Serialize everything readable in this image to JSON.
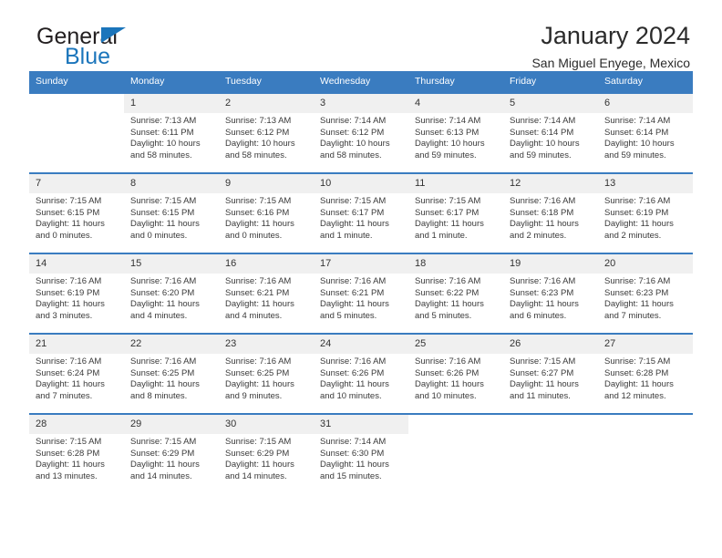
{
  "brand": {
    "name_dark": "General",
    "name_blue": "Blue",
    "accent_color": "#1b75bb"
  },
  "header": {
    "title": "January 2024",
    "subtitle": "San Miguel Enyege, Mexico"
  },
  "theme": {
    "header_row_bg": "#3a7cc0",
    "daynum_bg": "#f0f0f0",
    "text_color": "#3a3a3a"
  },
  "weekday_headers": [
    "Sunday",
    "Monday",
    "Tuesday",
    "Wednesday",
    "Thursday",
    "Friday",
    "Saturday"
  ],
  "weeks": [
    [
      {
        "day": "",
        "sunrise": "",
        "sunset": "",
        "daylight": ""
      },
      {
        "day": "1",
        "sunrise": "Sunrise: 7:13 AM",
        "sunset": "Sunset: 6:11 PM",
        "daylight": "Daylight: 10 hours and 58 minutes."
      },
      {
        "day": "2",
        "sunrise": "Sunrise: 7:13 AM",
        "sunset": "Sunset: 6:12 PM",
        "daylight": "Daylight: 10 hours and 58 minutes."
      },
      {
        "day": "3",
        "sunrise": "Sunrise: 7:14 AM",
        "sunset": "Sunset: 6:12 PM",
        "daylight": "Daylight: 10 hours and 58 minutes."
      },
      {
        "day": "4",
        "sunrise": "Sunrise: 7:14 AM",
        "sunset": "Sunset: 6:13 PM",
        "daylight": "Daylight: 10 hours and 59 minutes."
      },
      {
        "day": "5",
        "sunrise": "Sunrise: 7:14 AM",
        "sunset": "Sunset: 6:14 PM",
        "daylight": "Daylight: 10 hours and 59 minutes."
      },
      {
        "day": "6",
        "sunrise": "Sunrise: 7:14 AM",
        "sunset": "Sunset: 6:14 PM",
        "daylight": "Daylight: 10 hours and 59 minutes."
      }
    ],
    [
      {
        "day": "7",
        "sunrise": "Sunrise: 7:15 AM",
        "sunset": "Sunset: 6:15 PM",
        "daylight": "Daylight: 11 hours and 0 minutes."
      },
      {
        "day": "8",
        "sunrise": "Sunrise: 7:15 AM",
        "sunset": "Sunset: 6:15 PM",
        "daylight": "Daylight: 11 hours and 0 minutes."
      },
      {
        "day": "9",
        "sunrise": "Sunrise: 7:15 AM",
        "sunset": "Sunset: 6:16 PM",
        "daylight": "Daylight: 11 hours and 0 minutes."
      },
      {
        "day": "10",
        "sunrise": "Sunrise: 7:15 AM",
        "sunset": "Sunset: 6:17 PM",
        "daylight": "Daylight: 11 hours and 1 minute."
      },
      {
        "day": "11",
        "sunrise": "Sunrise: 7:15 AM",
        "sunset": "Sunset: 6:17 PM",
        "daylight": "Daylight: 11 hours and 1 minute."
      },
      {
        "day": "12",
        "sunrise": "Sunrise: 7:16 AM",
        "sunset": "Sunset: 6:18 PM",
        "daylight": "Daylight: 11 hours and 2 minutes."
      },
      {
        "day": "13",
        "sunrise": "Sunrise: 7:16 AM",
        "sunset": "Sunset: 6:19 PM",
        "daylight": "Daylight: 11 hours and 2 minutes."
      }
    ],
    [
      {
        "day": "14",
        "sunrise": "Sunrise: 7:16 AM",
        "sunset": "Sunset: 6:19 PM",
        "daylight": "Daylight: 11 hours and 3 minutes."
      },
      {
        "day": "15",
        "sunrise": "Sunrise: 7:16 AM",
        "sunset": "Sunset: 6:20 PM",
        "daylight": "Daylight: 11 hours and 4 minutes."
      },
      {
        "day": "16",
        "sunrise": "Sunrise: 7:16 AM",
        "sunset": "Sunset: 6:21 PM",
        "daylight": "Daylight: 11 hours and 4 minutes."
      },
      {
        "day": "17",
        "sunrise": "Sunrise: 7:16 AM",
        "sunset": "Sunset: 6:21 PM",
        "daylight": "Daylight: 11 hours and 5 minutes."
      },
      {
        "day": "18",
        "sunrise": "Sunrise: 7:16 AM",
        "sunset": "Sunset: 6:22 PM",
        "daylight": "Daylight: 11 hours and 5 minutes."
      },
      {
        "day": "19",
        "sunrise": "Sunrise: 7:16 AM",
        "sunset": "Sunset: 6:23 PM",
        "daylight": "Daylight: 11 hours and 6 minutes."
      },
      {
        "day": "20",
        "sunrise": "Sunrise: 7:16 AM",
        "sunset": "Sunset: 6:23 PM",
        "daylight": "Daylight: 11 hours and 7 minutes."
      }
    ],
    [
      {
        "day": "21",
        "sunrise": "Sunrise: 7:16 AM",
        "sunset": "Sunset: 6:24 PM",
        "daylight": "Daylight: 11 hours and 7 minutes."
      },
      {
        "day": "22",
        "sunrise": "Sunrise: 7:16 AM",
        "sunset": "Sunset: 6:25 PM",
        "daylight": "Daylight: 11 hours and 8 minutes."
      },
      {
        "day": "23",
        "sunrise": "Sunrise: 7:16 AM",
        "sunset": "Sunset: 6:25 PM",
        "daylight": "Daylight: 11 hours and 9 minutes."
      },
      {
        "day": "24",
        "sunrise": "Sunrise: 7:16 AM",
        "sunset": "Sunset: 6:26 PM",
        "daylight": "Daylight: 11 hours and 10 minutes."
      },
      {
        "day": "25",
        "sunrise": "Sunrise: 7:16 AM",
        "sunset": "Sunset: 6:26 PM",
        "daylight": "Daylight: 11 hours and 10 minutes."
      },
      {
        "day": "26",
        "sunrise": "Sunrise: 7:15 AM",
        "sunset": "Sunset: 6:27 PM",
        "daylight": "Daylight: 11 hours and 11 minutes."
      },
      {
        "day": "27",
        "sunrise": "Sunrise: 7:15 AM",
        "sunset": "Sunset: 6:28 PM",
        "daylight": "Daylight: 11 hours and 12 minutes."
      }
    ],
    [
      {
        "day": "28",
        "sunrise": "Sunrise: 7:15 AM",
        "sunset": "Sunset: 6:28 PM",
        "daylight": "Daylight: 11 hours and 13 minutes."
      },
      {
        "day": "29",
        "sunrise": "Sunrise: 7:15 AM",
        "sunset": "Sunset: 6:29 PM",
        "daylight": "Daylight: 11 hours and 14 minutes."
      },
      {
        "day": "30",
        "sunrise": "Sunrise: 7:15 AM",
        "sunset": "Sunset: 6:29 PM",
        "daylight": "Daylight: 11 hours and 14 minutes."
      },
      {
        "day": "31",
        "sunrise": "Sunrise: 7:14 AM",
        "sunset": "Sunset: 6:30 PM",
        "daylight": "Daylight: 11 hours and 15 minutes."
      },
      {
        "day": "",
        "sunrise": "",
        "sunset": "",
        "daylight": ""
      },
      {
        "day": "",
        "sunrise": "",
        "sunset": "",
        "daylight": ""
      },
      {
        "day": "",
        "sunrise": "",
        "sunset": "",
        "daylight": ""
      }
    ]
  ]
}
